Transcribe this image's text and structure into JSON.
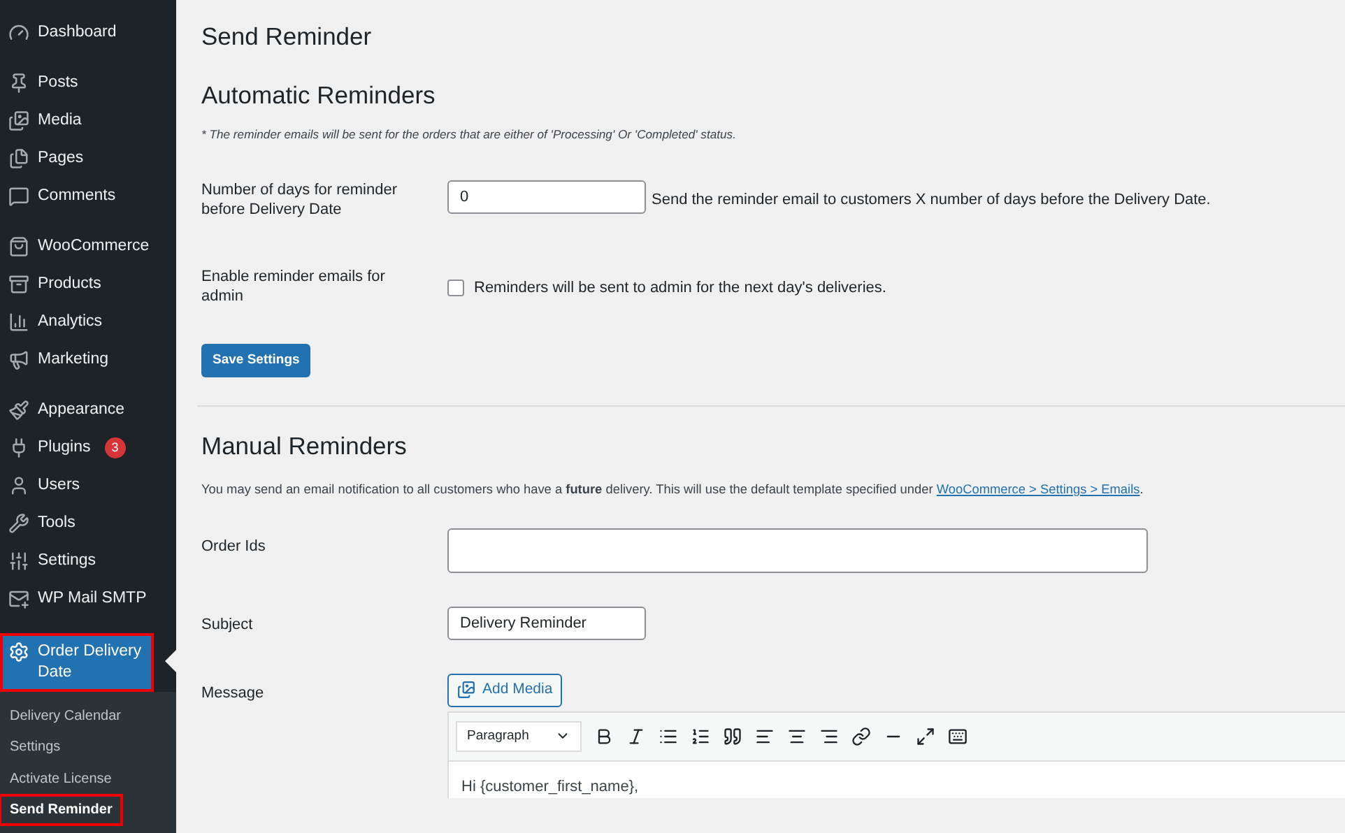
{
  "sidebar": {
    "items": [
      {
        "label": "Dashboard",
        "gap_before": false
      },
      {
        "label": "Posts",
        "gap_before": true
      },
      {
        "label": "Media",
        "gap_before": false
      },
      {
        "label": "Pages",
        "gap_before": false
      },
      {
        "label": "Comments",
        "gap_before": false
      },
      {
        "label": "WooCommerce",
        "gap_before": true
      },
      {
        "label": "Products",
        "gap_before": false
      },
      {
        "label": "Analytics",
        "gap_before": false
      },
      {
        "label": "Marketing",
        "gap_before": false
      },
      {
        "label": "Appearance",
        "gap_before": true
      },
      {
        "label": "Plugins",
        "gap_before": false,
        "badge": "3"
      },
      {
        "label": "Users",
        "gap_before": false
      },
      {
        "label": "Tools",
        "gap_before": false
      },
      {
        "label": "Settings",
        "gap_before": false
      },
      {
        "label": "WP Mail SMTP",
        "gap_before": false
      }
    ],
    "current": {
      "label": "Order Delivery Date",
      "selected": true,
      "highlighted": true
    },
    "submenu": [
      {
        "label": "Delivery Calendar",
        "selected": false,
        "highlighted": false
      },
      {
        "label": "Settings",
        "selected": false,
        "highlighted": false
      },
      {
        "label": "Activate License",
        "selected": false,
        "highlighted": false
      },
      {
        "label": "Send Reminder",
        "selected": true,
        "highlighted": true
      }
    ]
  },
  "page_title": "Send Reminder",
  "automatic": {
    "heading": "Automatic Reminders",
    "note": "* The reminder emails will be sent for the orders that are either of 'Processing' Or 'Completed' status.",
    "days": {
      "label": "Number of days for reminder before Delivery Date",
      "value": "0",
      "help": "Send the reminder email to customers X number of days before the Delivery Date."
    },
    "admin": {
      "label": "Enable reminder emails for admin",
      "checked": false,
      "help": "Reminders will be sent to admin for the next day's deliveries."
    },
    "save_button": "Save Settings"
  },
  "manual": {
    "heading": "Manual Reminders",
    "description": "You may send an email notification to all customers who have a **future** delivery. This will use the default template specified under",
    "link": "WooCommerce > Settings > Emails",
    "link_after": ".",
    "order_ids": {
      "label": "Order Ids"
    },
    "subject": {
      "label": "Subject",
      "value": "Delivery Reminder"
    },
    "message": {
      "label": "Message",
      "add_media": "Add Media",
      "format": "Paragraph",
      "body": "Hi {customer_first_name},"
    }
  }
}
